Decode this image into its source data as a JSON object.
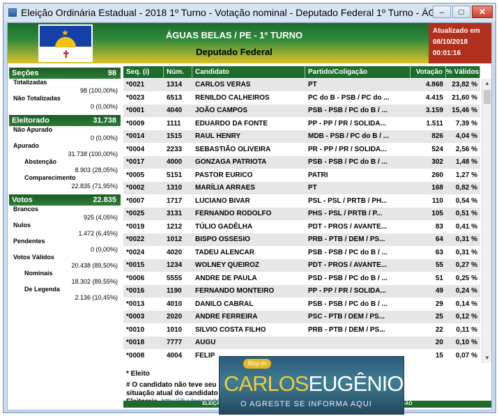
{
  "window": {
    "title": "Eleição Ordinária Estadual - 2018 1º Turno - Votação nominal - Deputado Federal 1º Turno - ÁGUAS BELAS",
    "controls": [
      "minimize",
      "maximize",
      "close"
    ]
  },
  "header": {
    "title": "ÁGUAS BELAS / PE - 1º TURNO",
    "subtitle": "Deputado Federal",
    "updated_label": "Atualizado em",
    "updated_date": "08/10/2018",
    "updated_time": "00:01:16"
  },
  "left": {
    "secoes": {
      "label": "Seções",
      "value": "98",
      "totalizadas_label": "Totalizadas",
      "totalizadas_value": "98 (100,00%)",
      "nao_totalizadas_label": "Não Totalizadas",
      "nao_totalizadas_value": "0 (0,00%)"
    },
    "eleitorado": {
      "label": "Eleitorado",
      "value": "31.738",
      "nao_apurado_label": "Não Apurado",
      "nao_apurado_value": "0 (0,00%)",
      "apurado_label": "Apurado",
      "apurado_value": "31.738 (100,00%)",
      "abstencao_label": "Abstenção",
      "abstencao_value": "8.903 (28,05%)",
      "comparecimento_label": "Comparecimento",
      "comparecimento_value": "22.835 (71,95%)"
    },
    "votos": {
      "label": "Votos",
      "value": "22.835",
      "brancos_label": "Brancos",
      "brancos_value": "925 (4,05%)",
      "nulos_label": "Nulos",
      "nulos_value": "1.472 (6,45%)",
      "pendentes_label": "Pendentes",
      "pendentes_value": "0 (0,00%)",
      "validos_label": "Votos Válidos",
      "validos_value": "20.438 (89,50%)",
      "nominais_label": "Nominais",
      "nominais_value": "18.302 (89,55%)",
      "legenda_label": "De Legenda",
      "legenda_value": "2.136 (10,45%)"
    }
  },
  "table": {
    "columns": [
      "Seq.  (i)",
      "Núm.",
      "Candidato",
      "Partido/Coligação",
      "Votação",
      "% Válidos"
    ],
    "rows": [
      [
        "*0021",
        "1314",
        "CARLOS VERAS",
        "PT",
        "4.868",
        "23,82 %"
      ],
      [
        "*0023",
        "6513",
        "RENILDO CALHEIROS",
        "PC do B - PSB / PC do ...",
        "4.415",
        "21,60 %"
      ],
      [
        "*0001",
        "4040",
        "JOÃO CAMPOS",
        "PSB - PSB / PC do B / ...",
        "3.159",
        "15,46 %"
      ],
      [
        "*0009",
        "1111",
        "EDUARDO DA FONTE",
        "PP - PP / PR / SOLIDA...",
        "1.511",
        "7,39 %"
      ],
      [
        "*0014",
        "1515",
        "RAUL HENRY",
        "MDB - PSB / PC do B / ...",
        "826",
        "4,04 %"
      ],
      [
        "*0004",
        "2233",
        "SEBASTIÃO OLIVEIRA",
        "PR - PP / PR / SOLIDA...",
        "524",
        "2,56 %"
      ],
      [
        "*0017",
        "4000",
        "GONZAGA PATRIOTA",
        "PSB - PSB / PC do B / ...",
        "302",
        "1,48 %"
      ],
      [
        "*0005",
        "5151",
        "PASTOR EURICO",
        "PATRI",
        "260",
        "1,27 %"
      ],
      [
        "*0002",
        "1310",
        "MARÍLIA ARRAES",
        "PT",
        "168",
        "0,82 %"
      ],
      [
        "*0007",
        "1717",
        "LUCIANO BIVAR",
        "PSL - PSL / PRTB / PH...",
        "110",
        "0,54 %"
      ],
      [
        "*0025",
        "3131",
        "FERNANDO RODOLFO",
        "PHS - PSL / PRTB / P...",
        "105",
        "0,51 %"
      ],
      [
        "*0019",
        "1212",
        "TÚLIO GADÊLHA",
        "PDT - PROS / AVANTE...",
        "83",
        "0,41 %"
      ],
      [
        "*0022",
        "1012",
        "BISPO OSSESIO",
        "PRB - PTB / DEM / PS...",
        "64",
        "0,31 %"
      ],
      [
        "*0024",
        "4020",
        "TADEU ALENCAR",
        "PSB - PSB / PC do B / ...",
        "63",
        "0,31 %"
      ],
      [
        "*0015",
        "1234",
        "WOLNEY QUEIROZ",
        "PDT - PROS / AVANTE...",
        "55",
        "0,27 %"
      ],
      [
        "*0006",
        "5555",
        "ANDRE DE PAULA",
        "PSD - PSB / PC do B / ...",
        "51",
        "0,25 %"
      ],
      [
        "*0016",
        "1190",
        "FERNANDO MONTEIRO",
        "PP - PP / PR / SOLIDA...",
        "49",
        "0,24 %"
      ],
      [
        "*0013",
        "4010",
        "DANILO CABRAL",
        "PSB - PSB / PC do B / ...",
        "29",
        "0,14 %"
      ],
      [
        "*0003",
        "2020",
        "ANDRE FERREIRA",
        "PSC - PTB / DEM / PS...",
        "25",
        "0,12 %"
      ],
      [
        "*0010",
        "1010",
        "SILVIO COSTA FILHO",
        "PRB - PTB / DEM / PS...",
        "22",
        "0,11 %"
      ],
      [
        "*0018",
        "7777",
        "AUGU",
        "",
        "20",
        "0,10 %"
      ],
      [
        "*0008",
        "4004",
        "FELIP",
        "",
        "15",
        "0,07 %"
      ]
    ]
  },
  "notes": {
    "eleito": "* Eleito",
    "line1": "# O candidato não teve seu                                                  ice ou à do seu partido. A",
    "line2": "situação atual do candidato",
    "line3": "Eleitorais.",
    "link": "http://divulgacandcontas.tse.jus.br"
  },
  "footer": "ELEIÇÃO ORDINÁRIA ESTADUAL - 2018 1º TURNO - RESULTADO SUJEITO À ALTERAÇÃO",
  "overlay": {
    "blog": "Blog do",
    "name_first": "CARLOS",
    "name_last": "EUGÊNIO",
    "tagline": "O AGRESTE SE INFORMA AQUI"
  },
  "colors": {
    "header_green": "#1d6b2d",
    "header_gold": "#d9c22a",
    "updated_red": "#b1301d",
    "row_alt": "#e6e6e6"
  }
}
